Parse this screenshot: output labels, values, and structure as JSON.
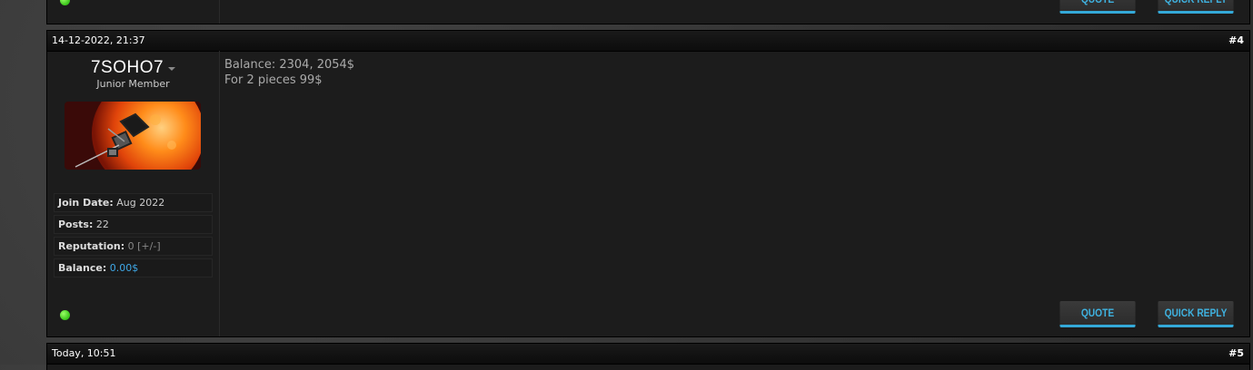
{
  "prev_post": {
    "buttons": {
      "quote": "QUOTE",
      "quick_reply": "QUICK REPLY"
    }
  },
  "post": {
    "date": "14-12-2022, 21:37",
    "number": "#4",
    "user": {
      "name": "7SOHO7",
      "title": "Junior Member",
      "avatar_icon": "sun-probe-avatar",
      "stats": {
        "join_date_label": "Join Date:",
        "join_date": "Aug 2022",
        "posts_label": "Posts:",
        "posts": "22",
        "reputation_label": "Reputation:",
        "reputation": "0",
        "reputation_link": "[+/-]",
        "balance_label": "Balance:",
        "balance": "0.00$"
      },
      "status": "online"
    },
    "message": [
      "Balance: 2304, 2054$",
      "For 2 pieces 99$"
    ],
    "buttons": {
      "quote": "QUOTE",
      "quick_reply": "QUICK REPLY"
    }
  },
  "next_post": {
    "date": "Today, 10:51",
    "number": "#5"
  },
  "colors": {
    "accent": "#34a9d8",
    "online": "#44cc22",
    "balance": "#3fa9e8"
  }
}
